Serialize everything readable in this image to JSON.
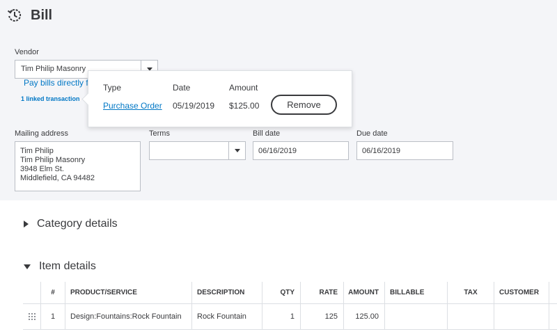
{
  "header": {
    "title": "Bill",
    "icon": "history-icon"
  },
  "vendor": {
    "label": "Vendor",
    "value": "Tim Philip Masonry"
  },
  "pay_bills_link": "Pay bills directly f",
  "linked_transaction": "1 linked transaction",
  "popover": {
    "headers": {
      "type": "Type",
      "date": "Date",
      "amount": "Amount"
    },
    "row": {
      "type": "Purchase Order",
      "date": "05/19/2019",
      "amount": "$125.00"
    },
    "remove_label": "Remove"
  },
  "mailing_address": {
    "label": "Mailing address",
    "lines": [
      "Tim Philip",
      "Tim Philip Masonry",
      "3948 Elm St.",
      "Middlefield, CA  94482"
    ]
  },
  "terms": {
    "label": "Terms",
    "value": ""
  },
  "bill_date": {
    "label": "Bill date",
    "value": "06/16/2019"
  },
  "due_date": {
    "label": "Due date",
    "value": "06/16/2019"
  },
  "sections": {
    "category": "Category details",
    "item": "Item details"
  },
  "item_table": {
    "columns": [
      "#",
      "PRODUCT/SERVICE",
      "DESCRIPTION",
      "QTY",
      "RATE",
      "AMOUNT",
      "BILLABLE",
      "TAX",
      "CUSTOMER"
    ],
    "rows": [
      {
        "num": "1",
        "product": "Design:Fountains:Rock Fountain",
        "description": "Rock Fountain",
        "qty": "1",
        "rate": "125",
        "amount": "125.00",
        "billable": "",
        "tax": "",
        "customer": ""
      }
    ]
  },
  "colors": {
    "accent": "#0077c5",
    "text": "#393a3d",
    "top_bg": "#f4f5f8",
    "border": "#babec5"
  }
}
